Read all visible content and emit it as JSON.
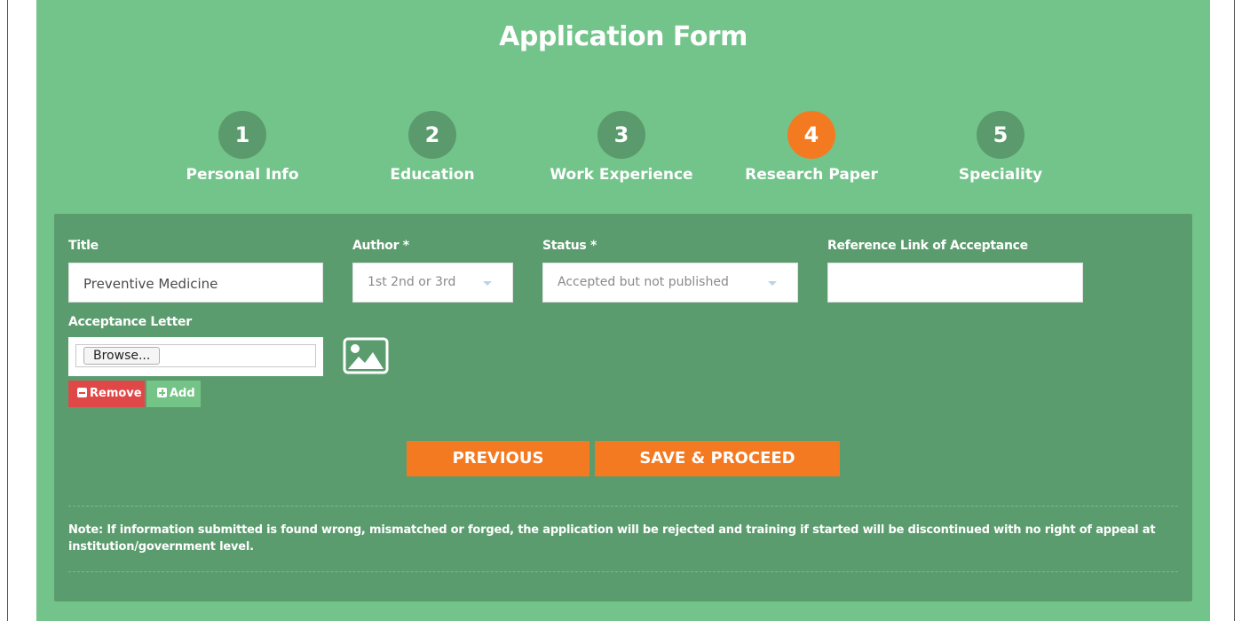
{
  "form": {
    "title": "Application Form"
  },
  "steps": [
    {
      "number": "1",
      "label": "Personal Info",
      "active": false
    },
    {
      "number": "2",
      "label": "Education",
      "active": false
    },
    {
      "number": "3",
      "label": "Work Experience",
      "active": false
    },
    {
      "number": "4",
      "label": "Research Paper",
      "active": true
    },
    {
      "number": "5",
      "label": "Speciality",
      "active": false
    }
  ],
  "fields": {
    "title": {
      "label": "Title",
      "value": "Preventive Medicine"
    },
    "author": {
      "label": "Author *",
      "selected": "1st 2nd or 3rd"
    },
    "status": {
      "label": "Status *",
      "selected": "Accepted but not published"
    },
    "reference": {
      "label": "Reference Link of Acceptance",
      "value": ""
    },
    "acceptance_letter": {
      "label": "Acceptance Letter",
      "browse_label": "Browse..."
    }
  },
  "buttons": {
    "remove": "Remove",
    "add": "Add",
    "previous": "PREVIOUS",
    "save_proceed": "SAVE & PROCEED"
  },
  "note": "Note: If information submitted is found wrong, mismatched or forged, the application will be rejected and training if started will be discontinued with no right of appeal at institution/government level.",
  "colors": {
    "panel": "#73c48a",
    "inner_panel": "#5b9c6e",
    "step_inactive": "#5a9a6c",
    "step_active": "#f47a22",
    "action": "#f47a22",
    "remove": "#e04848"
  },
  "icons": {
    "image_placeholder": "image-icon",
    "remove": "minus-square-icon",
    "add": "plus-square-icon",
    "select_caret": "caret-down-icon"
  }
}
